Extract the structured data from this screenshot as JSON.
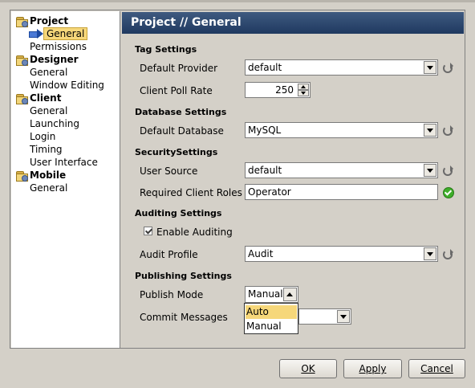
{
  "tree": {
    "groups": [
      {
        "label": "Project",
        "items": [
          "General",
          "Permissions"
        ]
      },
      {
        "label": "Designer",
        "items": [
          "General",
          "Window Editing"
        ]
      },
      {
        "label": "Client",
        "items": [
          "General",
          "Launching",
          "Login",
          "Timing",
          "User Interface"
        ]
      },
      {
        "label": "Mobile",
        "items": [
          "General"
        ]
      }
    ],
    "selected": "Project // General"
  },
  "header": {
    "title": "Project // General"
  },
  "tag_settings": {
    "title": "Tag Settings",
    "default_provider_label": "Default Provider",
    "default_provider_value": "default",
    "client_poll_rate_label": "Client Poll Rate",
    "client_poll_rate_value": "250"
  },
  "database_settings": {
    "title": "Database Settings",
    "default_database_label": "Default Database",
    "default_database_value": "MySQL"
  },
  "security_settings": {
    "title": "SecuritySettings",
    "user_source_label": "User Source",
    "user_source_value": "default",
    "required_roles_label": "Required Client Roles",
    "required_roles_value": "Operator"
  },
  "auditing_settings": {
    "title": "Auditing Settings",
    "enable_auditing_label": "Enable Auditing",
    "enable_auditing_checked": true,
    "audit_profile_label": "Audit Profile",
    "audit_profile_value": "Audit"
  },
  "publishing_settings": {
    "title": "Publishing Settings",
    "publish_mode_label": "Publish Mode",
    "publish_mode_value": "Manual",
    "publish_mode_options": [
      "Auto",
      "Manual"
    ],
    "highlighted_option": "Auto",
    "commit_messages_label": "Commit Messages"
  },
  "buttons": {
    "ok": "OK",
    "apply": "Apply",
    "cancel": "Cancel"
  },
  "colors": {
    "header_bg": "#2b4670",
    "selection": "#f6d77a",
    "confirm_icon": "#3fae2a"
  },
  "icons": [
    "folder-gear-icon",
    "blue-arrow-icon",
    "refresh-icon",
    "check-circle-icon",
    "dropdown-arrow-icon",
    "spinner-up-icon",
    "spinner-down-icon"
  ]
}
